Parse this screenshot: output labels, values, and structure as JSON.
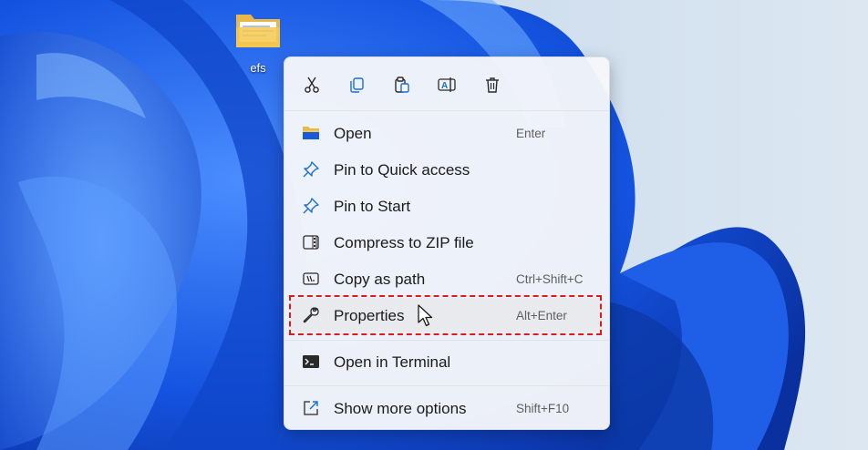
{
  "desktop": {
    "icon_name": "efs",
    "icon_type": "folder-icon"
  },
  "toolbar": {
    "buttons": [
      "cut-icon",
      "copy-icon",
      "paste-icon",
      "rename-icon",
      "delete-icon"
    ]
  },
  "menu": {
    "items": [
      {
        "label": "Open",
        "shortcut": "Enter",
        "icon": "folder-icon"
      },
      {
        "label": "Pin to Quick access",
        "shortcut": "",
        "icon": "pin-icon"
      },
      {
        "label": "Pin to Start",
        "shortcut": "",
        "icon": "pin-icon"
      },
      {
        "label": "Compress to ZIP file",
        "shortcut": "",
        "icon": "zip-icon"
      },
      {
        "label": "Copy as path",
        "shortcut": "Ctrl+Shift+C",
        "icon": "copy-path-icon"
      },
      {
        "label": "Properties",
        "shortcut": "Alt+Enter",
        "icon": "wrench-icon"
      },
      {
        "label": "Open in Terminal",
        "shortcut": "",
        "icon": "terminal-icon"
      },
      {
        "label": "Show more options",
        "shortcut": "Shift+F10",
        "icon": "share-icon"
      }
    ]
  },
  "colors": {
    "highlight_border": "#e0191b",
    "wallpaper_blue": "#1a5ae8",
    "menu_bg": "#f6f7fa"
  }
}
